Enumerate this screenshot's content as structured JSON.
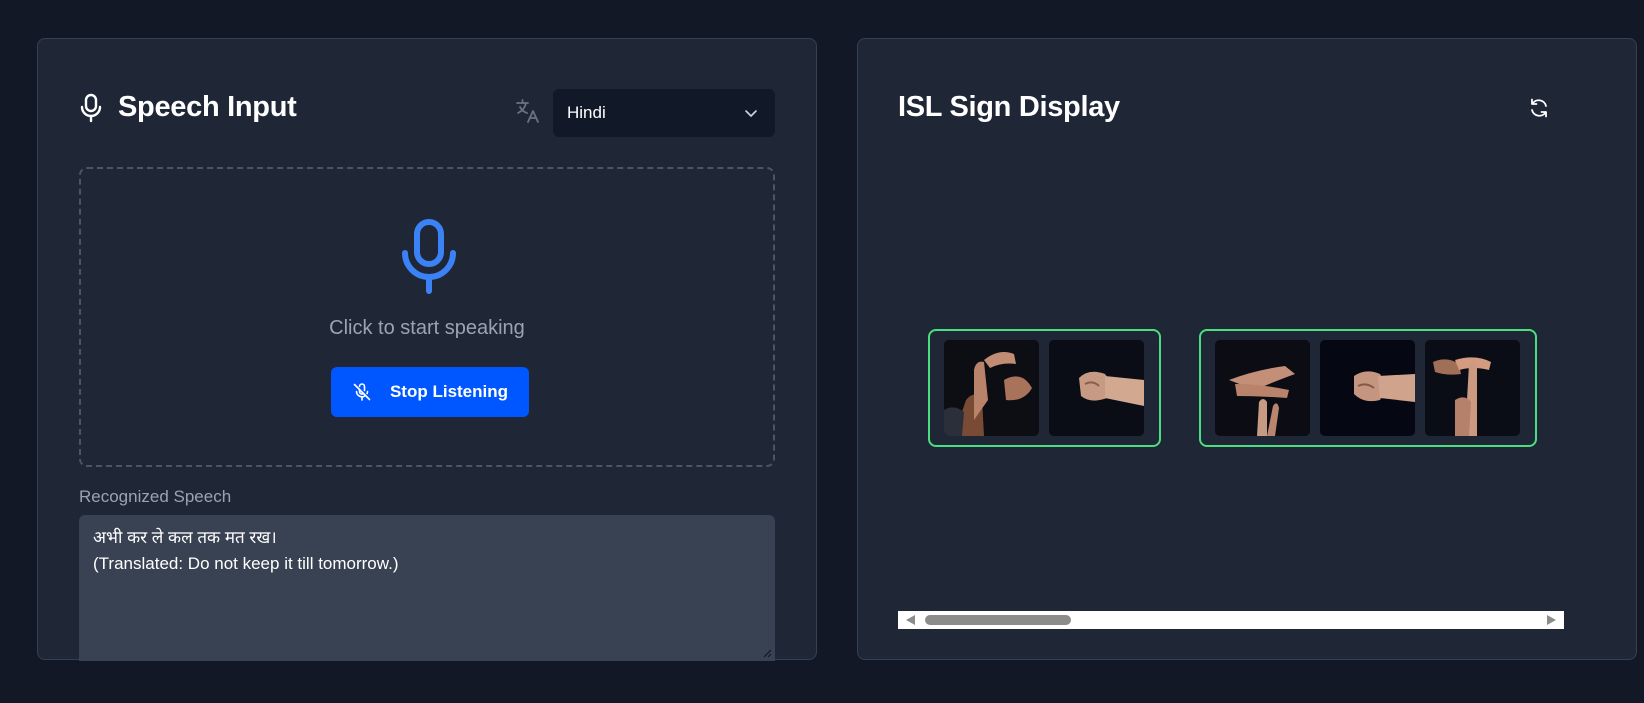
{
  "speech_panel": {
    "title": "Speech Input",
    "language": {
      "selected": "Hindi"
    },
    "drop_zone": {
      "hint": "Click to start speaking",
      "button_label": "Stop Listening"
    },
    "recognized": {
      "label": "Recognized Speech",
      "text_line1": "अभी कर ले कल तक मत रख।",
      "text_line2": "(Translated: Do not keep it till tomorrow.)"
    }
  },
  "sign_panel": {
    "title": "ISL Sign Display",
    "groups": [
      {
        "signs": [
          {
            "icon": "hand-sign-image"
          },
          {
            "icon": "hand-sign-image"
          }
        ]
      },
      {
        "signs": [
          {
            "icon": "hand-sign-image"
          },
          {
            "icon": "hand-sign-image"
          },
          {
            "icon": "hand-sign-image"
          }
        ]
      }
    ]
  },
  "colors": {
    "background": "#121826",
    "panel": "#1f2737",
    "accent_blue": "#0057ff",
    "mic_blue": "#3b82f6",
    "group_border": "#4ade80",
    "muted_text": "#9ca3af"
  }
}
